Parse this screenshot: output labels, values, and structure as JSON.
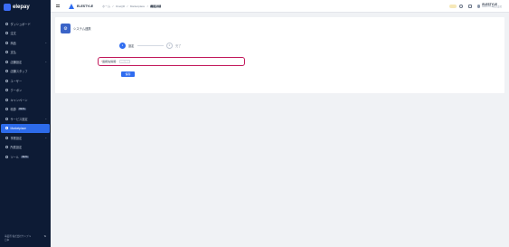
{
  "app": {
    "logo_text": "elepay"
  },
  "sidebar": {
    "items": [
      {
        "label": "ダッシュボード",
        "icon": "dashboard-icon"
      },
      {
        "label": "注文",
        "icon": "orders-icon"
      },
      {
        "label": "商品",
        "icon": "products-icon",
        "chevron": "⌄"
      },
      {
        "label": "支払",
        "icon": "payments-icon"
      },
      {
        "label": "店舗設定",
        "icon": "store-icon",
        "chevron": "⌄"
      },
      {
        "label": "店舗スタッフ",
        "icon": "staff-icon"
      },
      {
        "label": "ユーザー",
        "icon": "users-icon"
      },
      {
        "label": "クーポン",
        "icon": "coupon-icon"
      },
      {
        "label": "キャンペーン",
        "icon": "campaign-icon"
      },
      {
        "label": "精算",
        "icon": "settlement-icon",
        "badge": "BETA"
      },
      {
        "label": "サービス設定",
        "icon": "service-icon",
        "chevron": "⌄"
      },
      {
        "label": "Marketplace",
        "icon": "marketplace-icon",
        "active": true
      },
      {
        "label": "事業設定",
        "icon": "business-icon",
        "chevron": "⌄"
      },
      {
        "label": "所属設定",
        "icon": "affiliation-icon"
      },
      {
        "label": "ツール",
        "icon": "tools-icon",
        "badge": "BETA"
      }
    ],
    "footer": {
      "account_label": "事業所",
      "account_value": "株式会社サンプル",
      "sub_label": "日本"
    }
  },
  "header": {
    "brand": "ELESTYLE",
    "breadcrumb": [
      "ホーム",
      "OneQR",
      "Marketplace",
      "機能詳細"
    ],
    "user": {
      "name": "ELESTYLE",
      "org": "ELESTYLE株式会社"
    }
  },
  "card": {
    "title": "システム連携",
    "tile_glyph": "⚙",
    "steps": [
      {
        "number": "1",
        "label": "設定"
      },
      {
        "number": "2",
        "label": "完了"
      }
    ],
    "field": {
      "label": "連携先情報",
      "required_mark": "*",
      "placeholder": "入力してください"
    },
    "submit_label": "保存"
  }
}
